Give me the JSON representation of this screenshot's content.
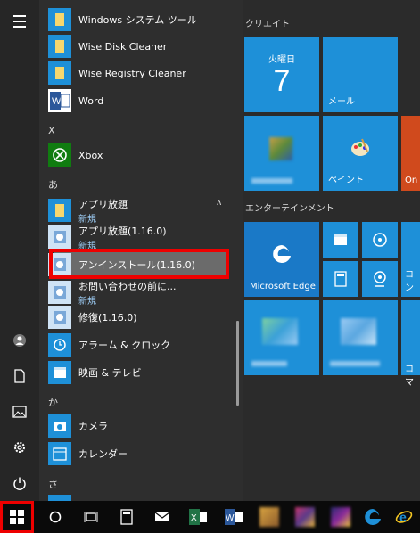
{
  "rail": {
    "items": [
      "hamburger-icon",
      "user-icon",
      "document-icon",
      "pictures-icon",
      "settings-icon",
      "power-icon"
    ]
  },
  "list": {
    "rows": [
      {
        "label": "Windows システム ツール",
        "type": "folder"
      },
      {
        "label": "Wise Disk Cleaner",
        "type": "folder"
      },
      {
        "label": "Wise Registry Cleaner",
        "type": "folder"
      },
      {
        "label": "Word",
        "type": "word"
      }
    ],
    "section_x": "X",
    "xbox_label": "Xbox",
    "section_a": "あ",
    "appli_folder": {
      "label": "アプリ放題",
      "sub": "新規"
    },
    "appli_item": {
      "label": "アプリ放題(1.16.0)",
      "sub": "新規"
    },
    "uninstall": {
      "label": "アンインストール(1.16.0)"
    },
    "inquiry": {
      "label": "お問い合わせの前に...",
      "sub": "新規"
    },
    "repair": {
      "label": "修復(1.16.0)"
    },
    "alarm": {
      "label": "アラーム & クロック"
    },
    "movies": {
      "label": "映画 & テレビ"
    },
    "section_ka": "か",
    "camera": {
      "label": "カメラ"
    },
    "calendar": {
      "label": "カレンダー"
    },
    "section_sa": "さ"
  },
  "tiles": {
    "group1_title": "クリエイト",
    "calendar_day": "火曜日",
    "calendar_date": "7",
    "mail_label": "メール",
    "paint_label": "ペイント",
    "on_label": "On",
    "group2_title": "エンターテインメント",
    "edge_label": "Microsoft Edge",
    "right_partial": "コン",
    "right_partial2": "コマ"
  },
  "colors": {
    "accent": "#1e90d8",
    "highlight": "#e00000"
  }
}
